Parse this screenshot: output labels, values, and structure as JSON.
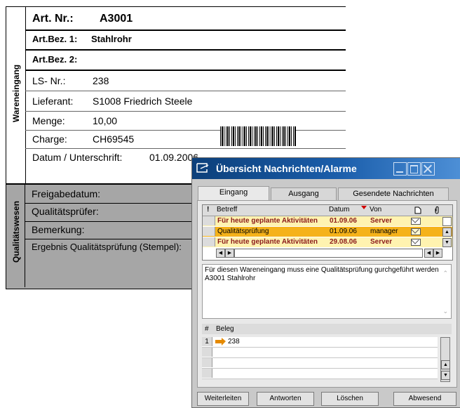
{
  "document": {
    "section_top_label": "Wareneingang",
    "section_bottom_label": "Qualitätswesen",
    "art_nr_label": "Art. Nr.:",
    "art_nr_value": "A3001",
    "art_bez1_label": "Art.Bez. 1:",
    "art_bez1_value": "Stahlrohr",
    "art_bez2_label": "Art.Bez. 2:",
    "ls_nr_label": "LS- Nr.:",
    "ls_nr_value": "238",
    "lieferant_label": "Lieferant:",
    "lieferant_value": "S1008 Friedrich Steele",
    "menge_label": "Menge:",
    "menge_value": "10,00",
    "charge_label": "Charge:",
    "charge_value": "CH69545",
    "datum_label": "Datum / Unterschrift:",
    "datum_value": "01.09.2006",
    "freigabe_label": "Freigabedatum:",
    "pruefer_label": "Qualitätsprüfer:",
    "bemerkung_label": "Bemerkung:",
    "ergebnis_label": "Ergebnis Qualitätsprüfung (Stempel):"
  },
  "window": {
    "title": "Übersicht Nachrichten/Alarme",
    "tabs": [
      "Eingang",
      "Ausgang",
      "Gesendete Nachrichten"
    ],
    "columns": {
      "prio": "!",
      "subject": "Betreff",
      "date": "Datum",
      "from": "Von"
    },
    "messages": [
      {
        "subject": "Für heute geplante Aktivitäten",
        "date": "01.09.06",
        "from": "Server"
      },
      {
        "subject": "Qualitätsprüfung",
        "date": "01.09.06",
        "from": "manager"
      },
      {
        "subject": "Für heute geplante Aktivitäten",
        "date": "29.08.06",
        "from": "Server"
      }
    ],
    "message_text_line1": "Für diesen Wareneingang muss eine Qualitätsprüfung gurchgeführt werden",
    "message_text_line2": "A3001 Stahlrohr",
    "beleg_columns": {
      "num": "#",
      "beleg": "Beleg"
    },
    "beleg_rows": [
      {
        "num": "1",
        "value": "238"
      }
    ],
    "buttons": {
      "forward": "Weiterleiten",
      "reply": "Antworten",
      "delete": "Löschen",
      "absent": "Abwesend"
    },
    "colors": {
      "title_bar": "#1b5eab",
      "row_highlight": "#f5b21a",
      "unread_text": "#8b1a1a"
    }
  }
}
